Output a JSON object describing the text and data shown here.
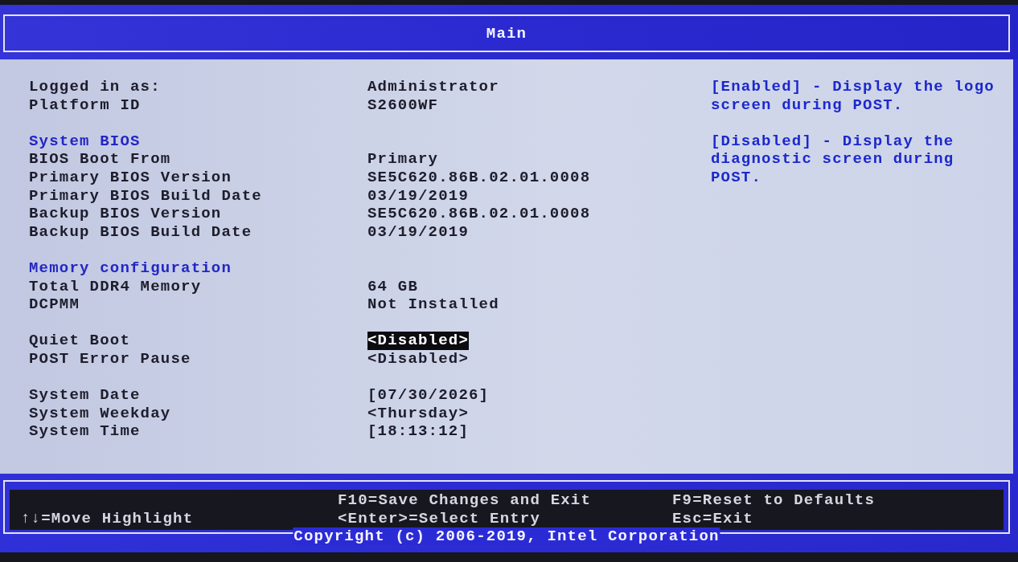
{
  "header": {
    "title": "Main"
  },
  "groups": [
    {
      "items": [
        {
          "label": "Logged in as:",
          "value": "Administrator",
          "selected": false
        },
        {
          "label": "Platform ID",
          "value": "S2600WF",
          "selected": false
        }
      ]
    },
    {
      "heading": "System BIOS",
      "items": [
        {
          "label": "BIOS Boot From",
          "value": "Primary",
          "selected": false
        },
        {
          "label": "Primary BIOS Version",
          "value": "SE5C620.86B.02.01.0008",
          "selected": false
        },
        {
          "label": "Primary BIOS Build Date",
          "value": "03/19/2019",
          "selected": false
        },
        {
          "label": "Backup BIOS Version",
          "value": "SE5C620.86B.02.01.0008",
          "selected": false
        },
        {
          "label": "Backup BIOS Build Date",
          "value": "03/19/2019",
          "selected": false
        }
      ]
    },
    {
      "heading": "Memory configuration",
      "items": [
        {
          "label": "Total DDR4 Memory",
          "value": "64 GB",
          "selected": false
        },
        {
          "label": "DCPMM",
          "value": "Not Installed",
          "selected": false
        }
      ]
    },
    {
      "items": [
        {
          "label": "Quiet Boot",
          "value": "<Disabled>",
          "selected": true
        },
        {
          "label": "POST Error Pause",
          "value": "<Disabled>",
          "selected": false
        }
      ]
    },
    {
      "items": [
        {
          "label": "System Date",
          "value": "[07/30/2026]",
          "selected": false
        },
        {
          "label": "System Weekday",
          "value": "<Thursday>",
          "selected": false
        },
        {
          "label": "System Time",
          "value": "[18:13:12]",
          "selected": false
        }
      ]
    }
  ],
  "help": [
    "[Enabled] - Display the logo screen during POST.",
    "[Disabled] - Display the diagnostic screen during POST."
  ],
  "footer": {
    "columns": [
      [
        "↑↓=Move Highlight"
      ],
      [
        "F10=Save Changes and Exit",
        "<Enter>=Select Entry"
      ],
      [
        "F9=Reset to Defaults",
        "Esc=Exit"
      ]
    ],
    "copyright": "Copyright (c) 2006-2019, Intel Corporation"
  }
}
